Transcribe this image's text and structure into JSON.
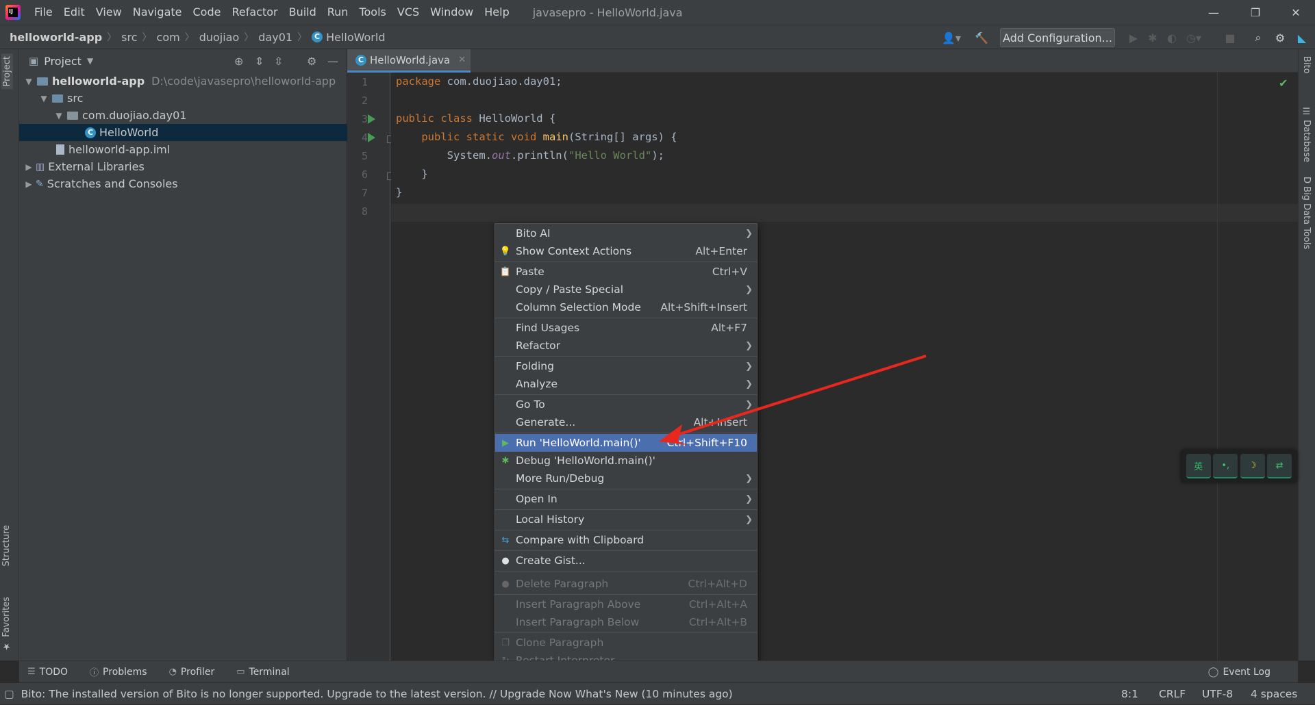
{
  "menubar": {
    "items": [
      "File",
      "Edit",
      "View",
      "Navigate",
      "Code",
      "Refactor",
      "Build",
      "Run",
      "Tools",
      "VCS",
      "Window",
      "Help"
    ],
    "window_title": "javasepro - HelloWorld.java",
    "minimize": "—",
    "restore": "❐",
    "close": "✕"
  },
  "breadcrumb": [
    "helloworld-app",
    "src",
    "com",
    "duojiao",
    "day01",
    "HelloWorld"
  ],
  "toolbar": {
    "add_config": "Add Configuration..."
  },
  "left_tabs": {
    "project": "Project",
    "structure": "Structure",
    "favorites": "Favorites"
  },
  "right_tabs": {
    "bito": "Bito",
    "database": "Database",
    "bigdata": "Big Data Tools"
  },
  "project_panel": {
    "title": "Project",
    "tree": [
      {
        "label": "helloworld-app",
        "path": "D:\\code\\javasepro\\helloworld-app"
      },
      {
        "label": "src"
      },
      {
        "label": "com.duojiao.day01"
      },
      {
        "label": "HelloWorld"
      },
      {
        "label": "helloworld-app.iml"
      },
      {
        "label": "External Libraries"
      },
      {
        "label": "Scratches and Consoles"
      }
    ]
  },
  "editor": {
    "tab_label": "HelloWorld.java",
    "line_numbers": [
      "1",
      "2",
      "3",
      "4",
      "5",
      "6",
      "7",
      "8"
    ],
    "code": {
      "l1_kw": "package",
      "l1_rest": " com.duojiao.day01;",
      "l3_kw": "public class",
      "l3_rest": " HelloWorld {",
      "l4_kw": "public static void",
      "l4_fn": "main",
      "l4_rest": "(String[] args) {",
      "l5_a": "System.",
      "l5_static": "out",
      "l5_b": ".println(",
      "l5_str": "\"Hello World\"",
      "l5_c": ");",
      "l6": "}",
      "l7": "}"
    }
  },
  "context_menu": {
    "items": [
      {
        "label": "Bito AI",
        "shortcut": ""
      },
      {
        "label": "Show Context Actions",
        "shortcut": "Alt+Enter"
      },
      {
        "label": "Paste",
        "shortcut": "Ctrl+V"
      },
      {
        "label": "Copy / Paste Special",
        "shortcut": ""
      },
      {
        "label": "Column Selection Mode",
        "shortcut": "Alt+Shift+Insert"
      },
      {
        "label": "Find Usages",
        "shortcut": "Alt+F7"
      },
      {
        "label": "Refactor",
        "shortcut": ""
      },
      {
        "label": "Folding",
        "shortcut": ""
      },
      {
        "label": "Analyze",
        "shortcut": ""
      },
      {
        "label": "Go To",
        "shortcut": ""
      },
      {
        "label": "Generate...",
        "shortcut": "Alt+Insert"
      },
      {
        "label": "Run 'HelloWorld.main()'",
        "shortcut": "Ctrl+Shift+F10"
      },
      {
        "label": "Debug 'HelloWorld.main()'",
        "shortcut": ""
      },
      {
        "label": "More Run/Debug",
        "shortcut": ""
      },
      {
        "label": "Open In",
        "shortcut": ""
      },
      {
        "label": "Local History",
        "shortcut": ""
      },
      {
        "label": "Compare with Clipboard",
        "shortcut": ""
      },
      {
        "label": "Create Gist...",
        "shortcut": ""
      },
      {
        "label": "Delete Paragraph",
        "shortcut": "Ctrl+Alt+D"
      },
      {
        "label": "Insert Paragraph Above",
        "shortcut": "Ctrl+Alt+A"
      },
      {
        "label": "Insert Paragraph Below",
        "shortcut": "Ctrl+Alt+B"
      },
      {
        "label": "Clone Paragraph",
        "shortcut": ""
      },
      {
        "label": "Restart Interpreter",
        "shortcut": ""
      }
    ]
  },
  "floating_toolbar": {
    "b1": "英",
    "b2": "•,",
    "b3": "☽",
    "b4": "⇄"
  },
  "bottom_tabs": {
    "todo": "TODO",
    "problems": "Problems",
    "profiler": "Profiler",
    "terminal": "Terminal",
    "event_log": "Event Log"
  },
  "statusbar": {
    "message": "Bito: The installed version of Bito is no longer supported. Upgrade to the latest version. // Upgrade Now   What's New (10 minutes ago)",
    "position": "8:1",
    "line_sep": "CRLF",
    "encoding": "UTF-8",
    "indent": "4 spaces"
  },
  "colors": {
    "accent": "#4b6eaf",
    "run_green": "#499c54",
    "annotation_arrow": "#e8281e"
  }
}
